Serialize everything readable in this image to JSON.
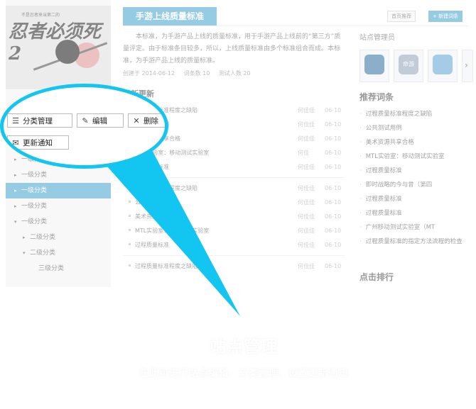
{
  "cover": {
    "small_text": "不是忍者来当第二的",
    "title": "忍者必须死2"
  },
  "sidebar": {
    "tree": [
      {
        "label": "一级分类",
        "level": 1,
        "arrow": "▸",
        "selected": false
      },
      {
        "label": "一级分类",
        "level": 1,
        "arrow": "▸",
        "selected": false
      },
      {
        "label": "一级分类",
        "level": 1,
        "arrow": "▸",
        "selected": true
      },
      {
        "label": "一级分类",
        "level": 1,
        "arrow": "▸",
        "selected": false
      },
      {
        "label": "一级分类",
        "level": 1,
        "arrow": "▾",
        "selected": false
      },
      {
        "label": "二级分类",
        "level": 2,
        "arrow": "▸",
        "selected": false
      },
      {
        "label": "二级分类",
        "level": 2,
        "arrow": "▾",
        "selected": false
      },
      {
        "label": "三级分类",
        "level": 3,
        "arrow": "",
        "selected": false
      }
    ]
  },
  "header": {
    "title": "手游上线质量标准",
    "home_button": "首页推荐",
    "new_button": "+ 新建词条"
  },
  "description": "本标准，为手游产品上线的质量标准，用于手游产品上线前的“第三方”质量评定。由于标准条目较多，所以，上线质量标准由多个标准组合而成。本标准，为手游产品上线的质量标准。",
  "meta": {
    "created": "创建于 2014-06-12",
    "terms": "词条数 10",
    "testers": "测试人数 20"
  },
  "section_title": "最新更新",
  "list": [
    {
      "text": "过程质量标准程度之缺陷",
      "author": "何佳佳",
      "date": "06-10"
    },
    {
      "text": "公共测试用例",
      "author": "何佳佳",
      "date": "06-10"
    },
    {
      "text": "美术资源共享合格",
      "author": "何佳佳",
      "date": "06-10"
    },
    {
      "text": "MTL实验室：移动测试实验室",
      "author": "何佳",
      "date": "06-10"
    },
    {
      "text": "过程质量标准",
      "author": "何佳佳",
      "date": "06-10"
    },
    {
      "sep": true
    },
    {
      "text": "过程质量标准程度之缺陷",
      "author": "何佳佳",
      "date": "06-10"
    },
    {
      "text": "公共测试用例",
      "author": "何佳佳",
      "date": "06-10"
    },
    {
      "text": "美术资源共享合格",
      "author": "何佳佳",
      "date": "06-10"
    },
    {
      "text": "MTL实验室：移动测试实验室",
      "author": "何佳佳",
      "date": "06-10"
    },
    {
      "text": "过程质量标准",
      "author": "何佳佳",
      "date": "06-10"
    },
    {
      "sep": true
    },
    {
      "text": "过程质量标准程度之缺陷",
      "author": "何佳佳",
      "date": "06-10"
    }
  ],
  "right": {
    "admins_title": "站点管理员",
    "logo2_text": "命游",
    "recommend_title": "推荐词条",
    "recommend": [
      "过程质量标准程度之缺陷",
      "公共测试用例",
      "美术资源共享合格",
      "MTL实验室：移动测试实验室",
      "过程质量标准",
      "即时战略的今与昔（第四",
      "过程质量标准",
      "过程质量标准",
      "广州移动测试实验室（MT",
      "过程质量标准的指定方法流程的检查"
    ],
    "rank_title": "点击排行"
  },
  "toolbar": {
    "category_manage": "分类管理",
    "edit": "编辑",
    "delete": "删除",
    "update_notice": "更新通知"
  },
  "caption": {
    "title": "站点管理",
    "subtitle": "在此可进行站点编辑、分类管理、设置更新通知"
  },
  "colors": {
    "accent": "#3ea0cd",
    "callout": "#13c5f1"
  }
}
